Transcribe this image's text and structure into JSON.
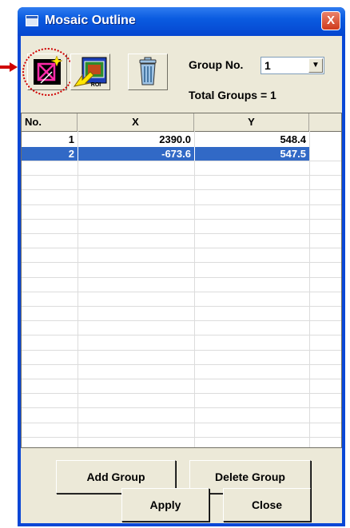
{
  "window": {
    "title": "Mosaic Outline",
    "close_label": "X"
  },
  "toolbar": {
    "buttons": [
      {
        "icon": "mosaic-outline-icon"
      },
      {
        "icon": "roi-import-icon",
        "roi_text": "ROI"
      },
      {
        "icon": "trash-icon"
      }
    ],
    "group_label": "Group No.",
    "group_value": "1",
    "total_groups_label": "Total Groups = 1"
  },
  "table": {
    "headers": [
      "No.",
      "X",
      "Y"
    ],
    "rows": [
      {
        "no": "1",
        "x": "2390.0",
        "y": "548.4",
        "selected": false
      },
      {
        "no": "2",
        "x": "-673.6",
        "y": "547.5",
        "selected": true
      }
    ]
  },
  "buttons": {
    "add_group": "Add Group",
    "delete_group": "Delete Group",
    "apply": "Apply",
    "close": "Close"
  },
  "colors": {
    "selection": "#3169c6",
    "annotation": "#d00000",
    "titlebar": "#0a5be0"
  }
}
